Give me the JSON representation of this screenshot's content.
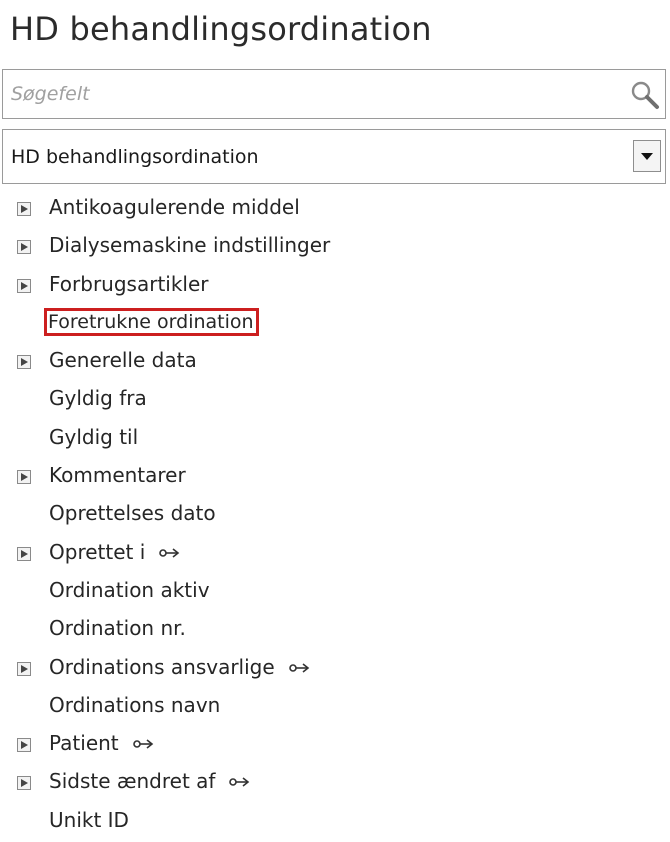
{
  "title": "HD behandlingsordination",
  "search": {
    "placeholder": "Søgefelt",
    "icon": "search-icon"
  },
  "select": {
    "value": "HD behandlingsordination",
    "icon": "dropdown-arrow-icon"
  },
  "tree": [
    {
      "label": "Antikoagulerende middel",
      "expandable": true,
      "link": false
    },
    {
      "label": "Dialysemaskine indstillinger",
      "expandable": true,
      "link": false
    },
    {
      "label": "Forbrugsartikler",
      "expandable": true,
      "link": false
    },
    {
      "label": "Foretrukne ordination",
      "expandable": false,
      "link": false,
      "highlighted": true
    },
    {
      "label": "Generelle data",
      "expandable": true,
      "link": false
    },
    {
      "label": "Gyldig fra",
      "expandable": false,
      "link": false
    },
    {
      "label": "Gyldig til",
      "expandable": false,
      "link": false
    },
    {
      "label": "Kommentarer",
      "expandable": true,
      "link": false
    },
    {
      "label": "Oprettelses dato",
      "expandable": false,
      "link": false
    },
    {
      "label": "Oprettet i",
      "expandable": true,
      "link": true
    },
    {
      "label": "Ordination aktiv",
      "expandable": false,
      "link": false
    },
    {
      "label": "Ordination nr.",
      "expandable": false,
      "link": false
    },
    {
      "label": "Ordinations ansvarlige",
      "expandable": true,
      "link": true
    },
    {
      "label": "Ordinations navn",
      "expandable": false,
      "link": false
    },
    {
      "label": "Patient",
      "expandable": true,
      "link": true
    },
    {
      "label": "Sidste ændret af",
      "expandable": true,
      "link": true
    },
    {
      "label": "Unikt ID",
      "expandable": false,
      "link": false
    }
  ],
  "colors": {
    "highlight": "#cc1f1f",
    "border": "#9a9a9a",
    "placeholder": "#a0a0a0"
  }
}
